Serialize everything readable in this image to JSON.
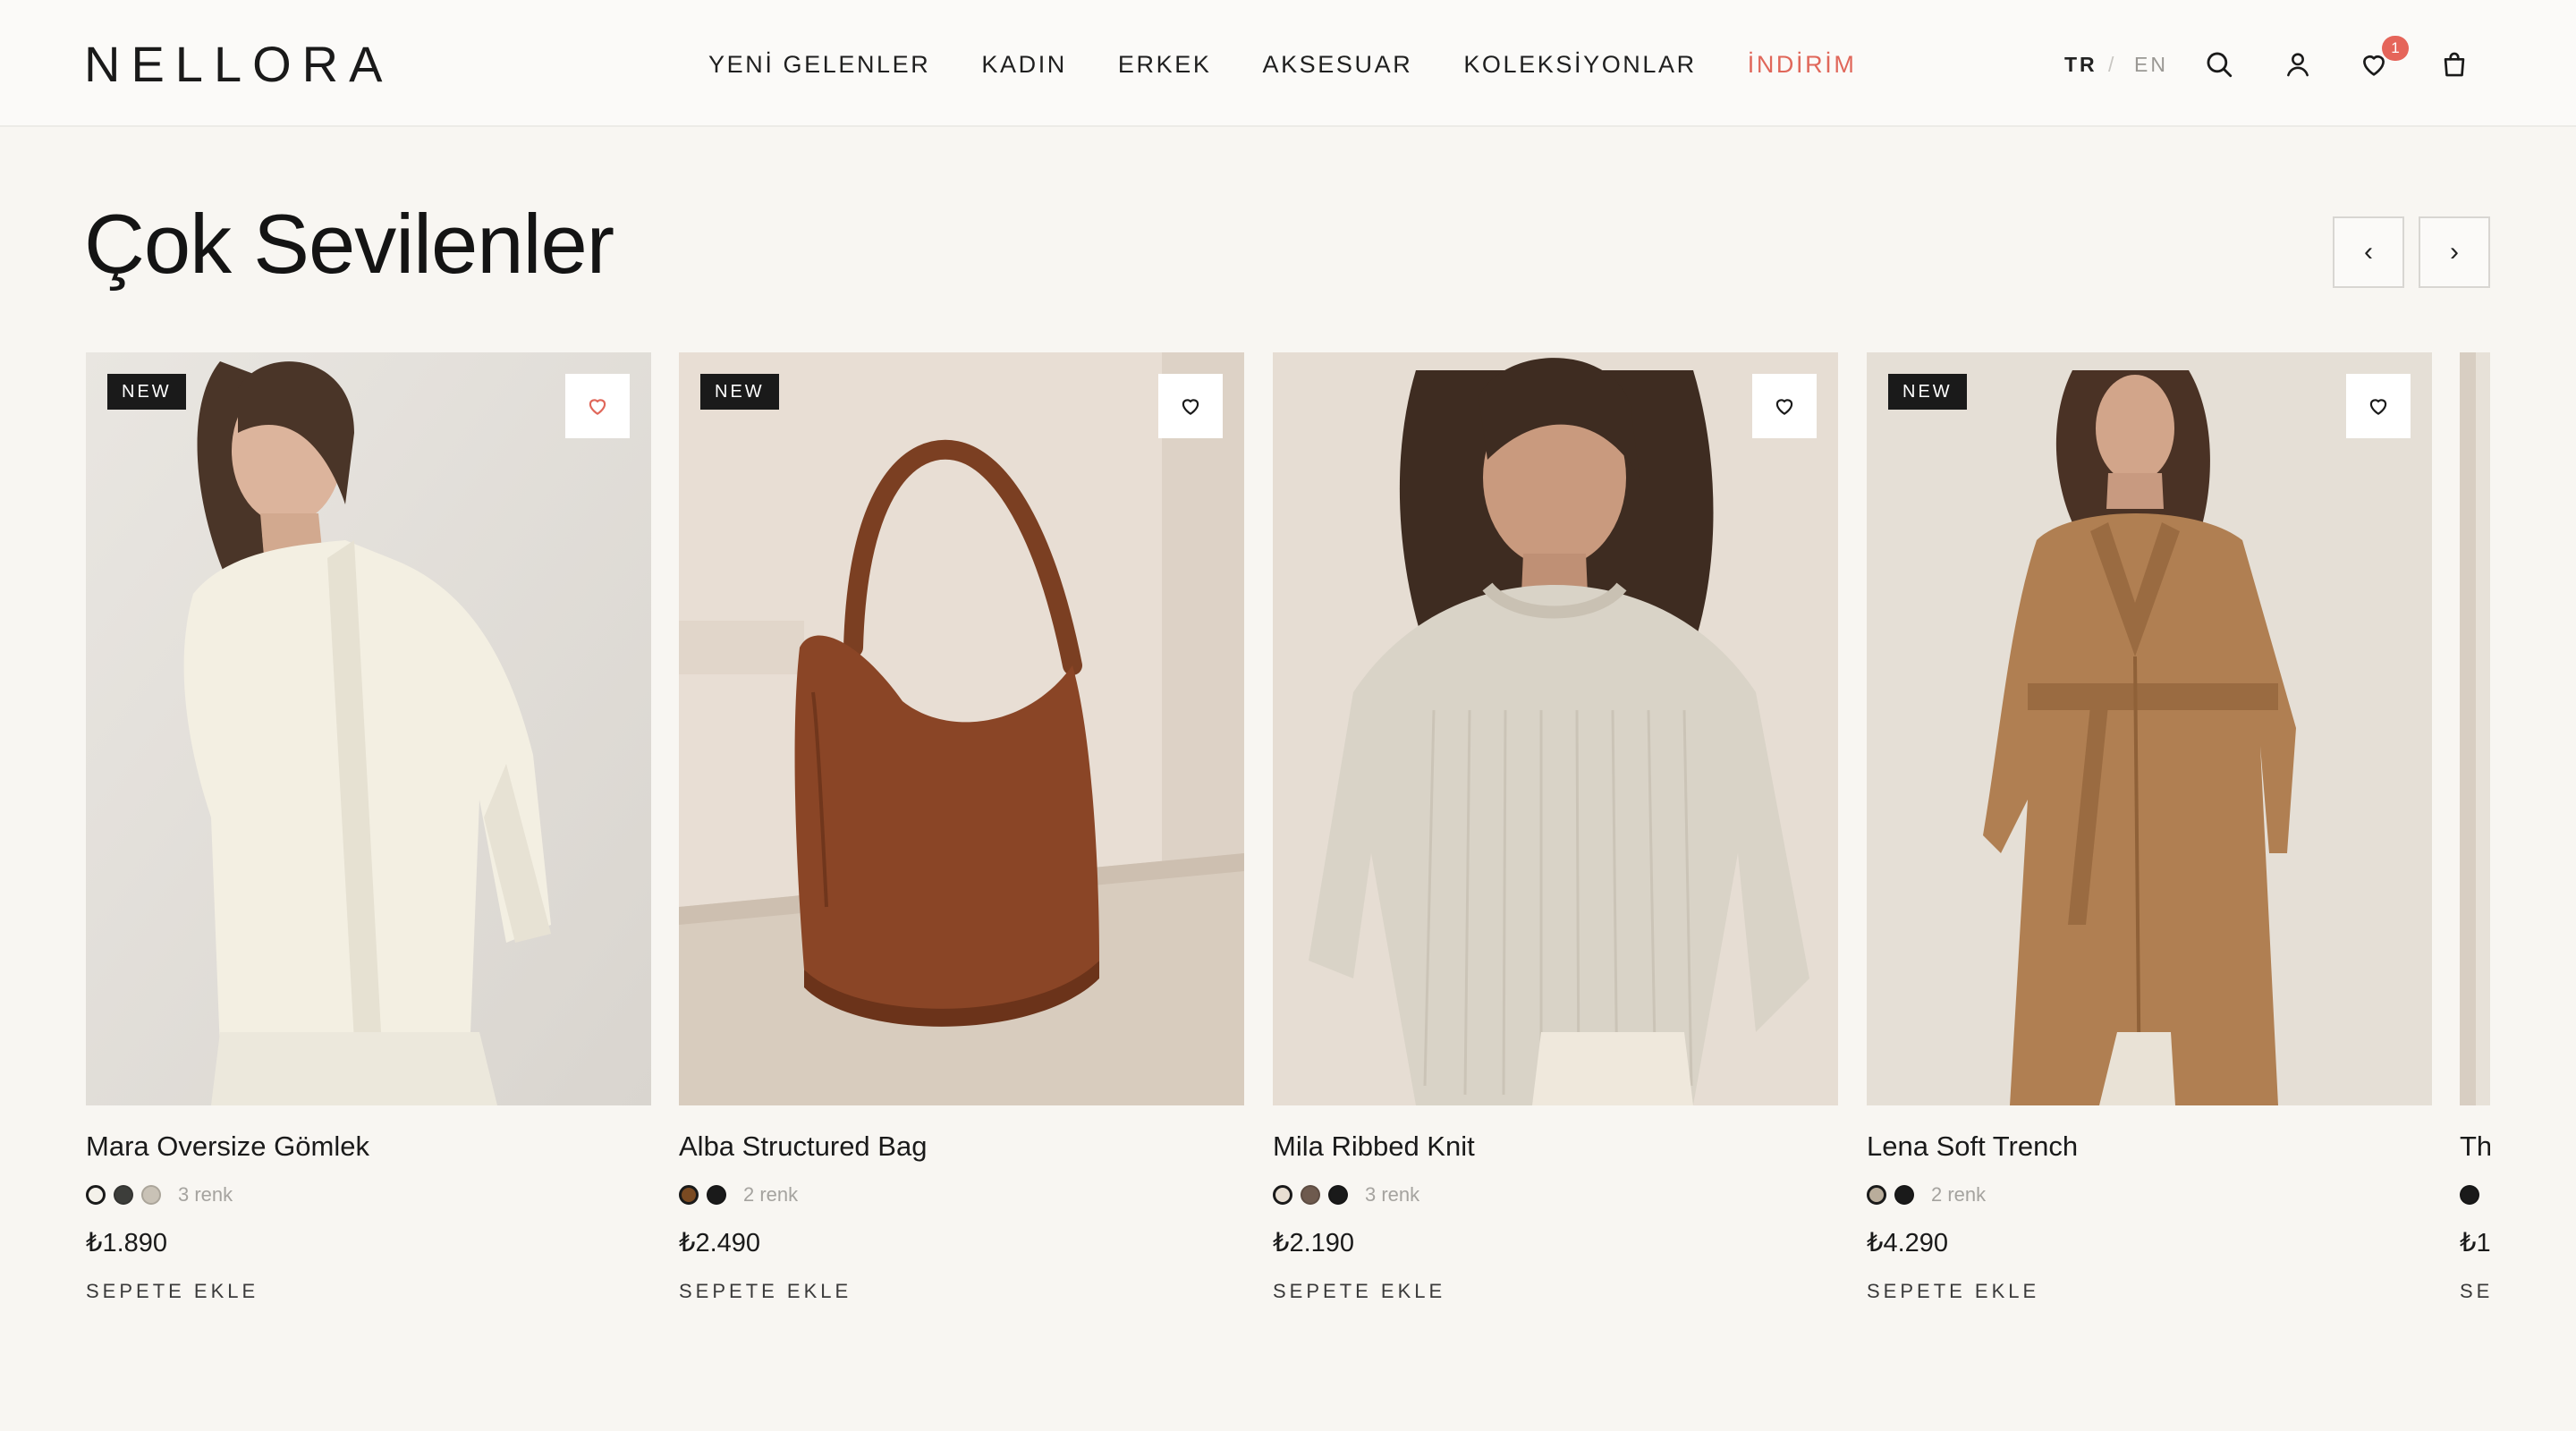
{
  "brand": {
    "logo": "NELLORA"
  },
  "nav": [
    {
      "label": "YENİ GELENLER"
    },
    {
      "label": "KADIN"
    },
    {
      "label": "ERKEK"
    },
    {
      "label": "AKSESUAR"
    },
    {
      "label": "KOLEKSİYONLAR"
    },
    {
      "label": "İNDİRİM",
      "color": "#e0675a"
    }
  ],
  "header": {
    "lang_tr": "TR",
    "lang_sep": "/",
    "lang_en": "EN",
    "icons": [
      "search-icon",
      "user-icon",
      "heart-icon",
      "bag-icon"
    ],
    "wishlist_count": "1"
  },
  "section": {
    "title": "Çok Sevilenler",
    "prev_arrow": "‹",
    "next_arrow": "›"
  },
  "products": [
    {
      "name": "Mara Oversize Gömlek",
      "badge": "NEW",
      "swatches": [
        "#f4f1ea",
        "#3c3d3a",
        "#c9c2b6"
      ],
      "colors_label": "3 renk",
      "price": "₺1.890",
      "cta": "SEPETE EKLE",
      "favorited": true
    },
    {
      "name": "Alba Structured Bag",
      "badge": "NEW",
      "swatches": [
        "#7a4a22",
        "#1a1a1a"
      ],
      "colors_label": "2 renk",
      "price": "₺2.490",
      "cta": "SEPETE EKLE",
      "favorited": false
    },
    {
      "name": "Mila Ribbed Knit",
      "badge": "",
      "swatches": [
        "#e8ded2",
        "#6e5a4e",
        "#1a1a1a"
      ],
      "colors_label": "3 renk",
      "price": "₺2.190",
      "cta": "SEPETE EKLE",
      "favorited": false
    },
    {
      "name": "Lena Soft Trench",
      "badge": "NEW",
      "swatches": [
        "#b9ad9b",
        "#1a1a1a"
      ],
      "colors_label": "2 renk",
      "price": "₺4.290",
      "cta": "SEPETE EKLE",
      "favorited": false
    },
    {
      "name": "Th",
      "badge": "",
      "swatches": [
        "#1a1a1a"
      ],
      "colors_label": "",
      "price": "₺1.",
      "cta": "SE",
      "favorited": false
    }
  ]
}
